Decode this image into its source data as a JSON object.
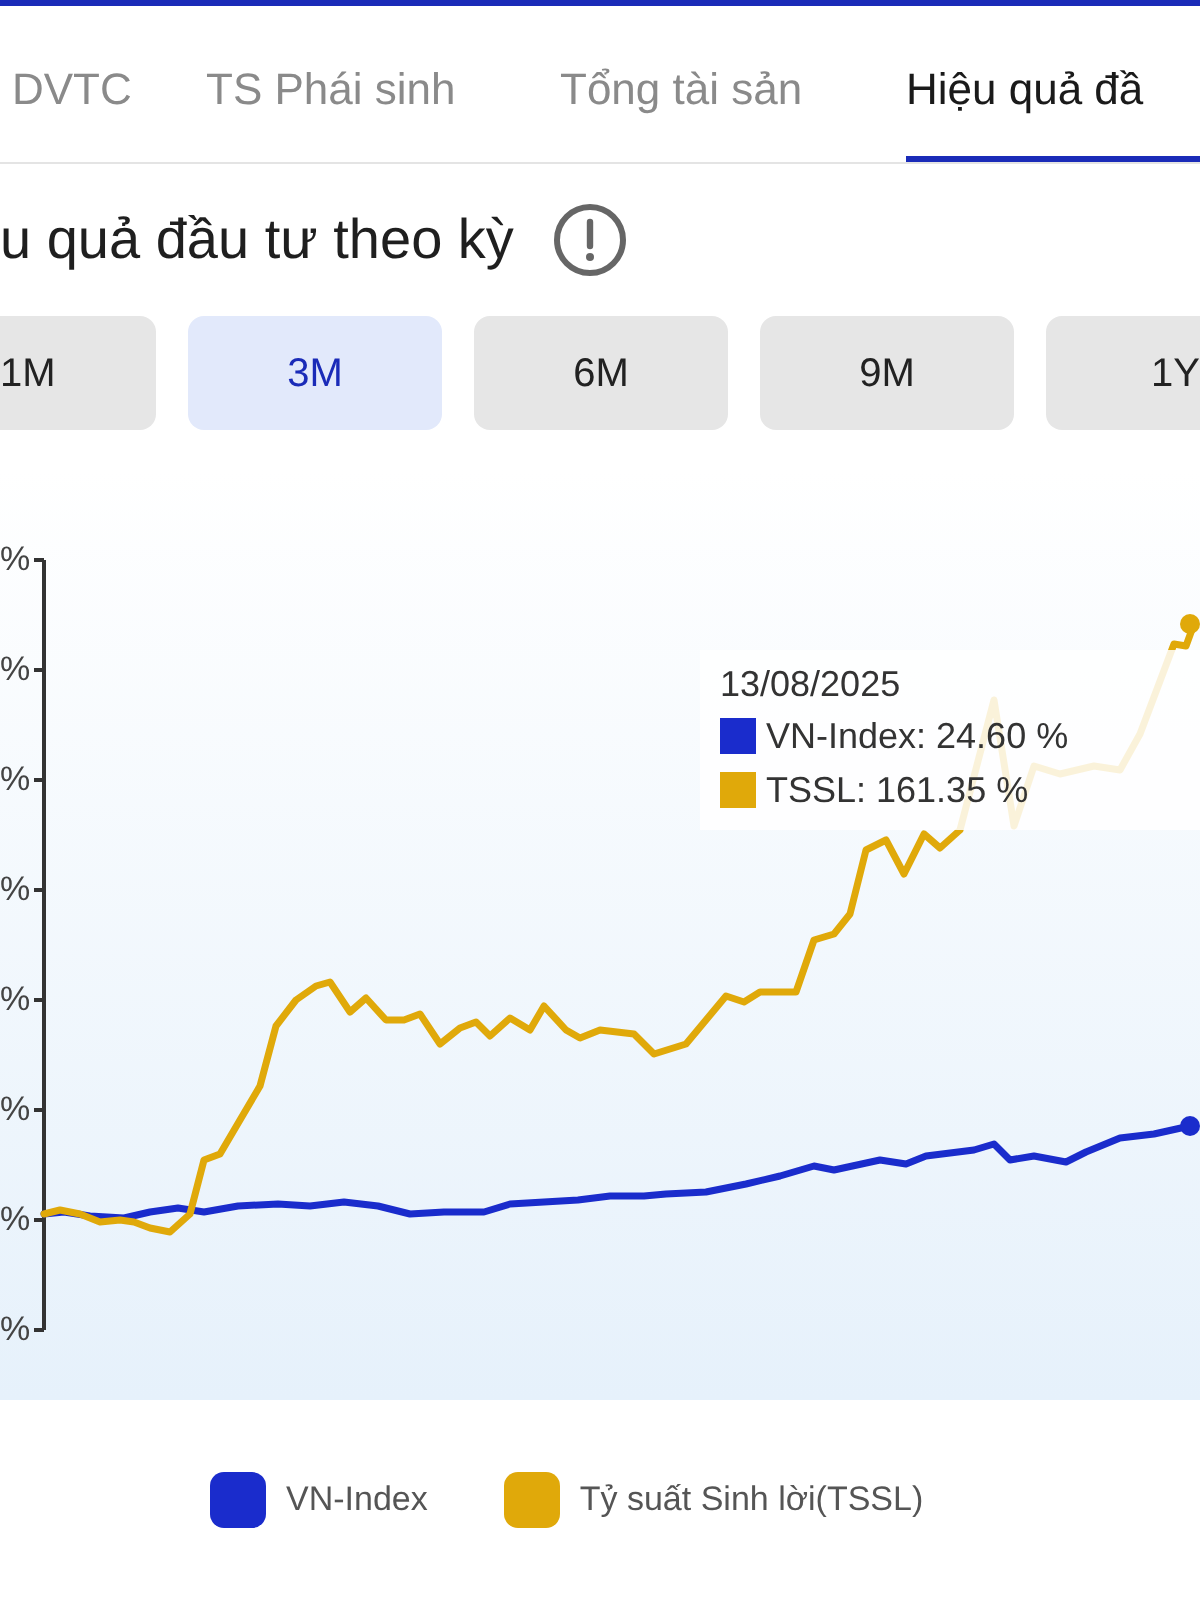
{
  "tabs": [
    {
      "label": "DVTC",
      "selected": false
    },
    {
      "label": "TS Phái sinh",
      "selected": false
    },
    {
      "label": "Tổng tài sản",
      "selected": false
    },
    {
      "label": "Hiệu quả đầ",
      "selected": true
    }
  ],
  "section": {
    "title": "u quả đầu tư theo kỳ"
  },
  "periods": [
    {
      "label": "1M",
      "selected": false
    },
    {
      "label": "3M",
      "selected": true
    },
    {
      "label": "6M",
      "selected": false
    },
    {
      "label": "9M",
      "selected": false
    },
    {
      "label": "1Y",
      "selected": false
    }
  ],
  "chart": {
    "y_axis_labels": [
      "%",
      "%",
      "%",
      "%",
      "%",
      "%",
      "%",
      "%"
    ],
    "tooltip": {
      "date": "13/08/2025",
      "rows": [
        {
          "label": "VN-Index: 24.60 %",
          "color": "#1a2ccc"
        },
        {
          "label": "TSSL: 161.35 %",
          "color": "#e0a90a"
        }
      ]
    },
    "legend": [
      {
        "label": "VN-Index",
        "color": "#1a2ccc"
      },
      {
        "label": "Tỷ suất Sinh lời(TSSL)",
        "color": "#e0a90a"
      }
    ]
  }
}
